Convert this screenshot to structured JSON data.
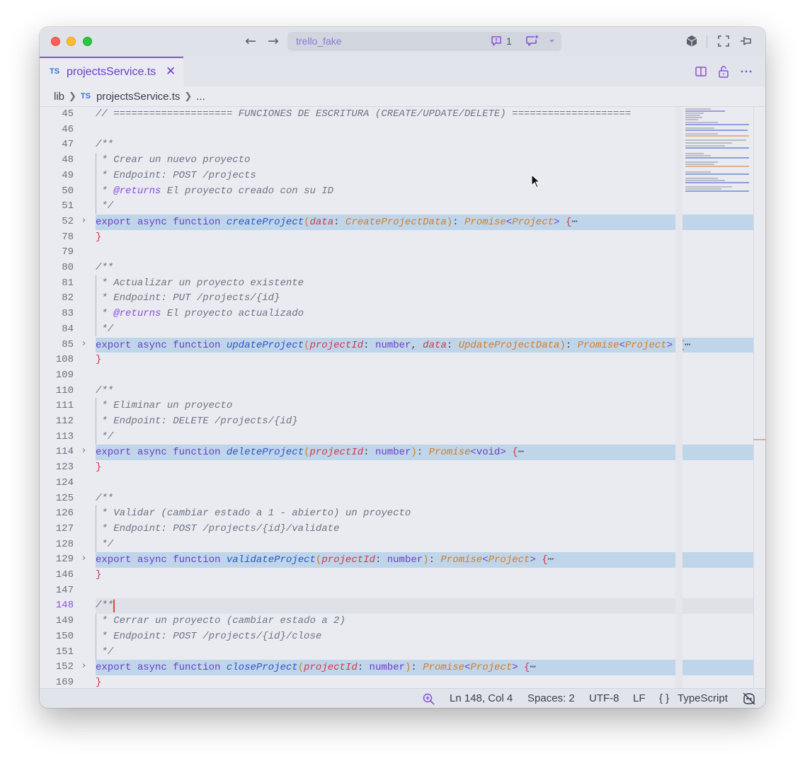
{
  "titlebar": {
    "search_text": "trello_fake",
    "notifications_count": "1"
  },
  "tab": {
    "badge": "TS",
    "label": "projectsService.ts",
    "close": "✕"
  },
  "breadcrumb": {
    "folder": "lib",
    "file": "projectsService.ts",
    "more": "..."
  },
  "editor": {
    "lines": [
      {
        "n": "45"
      },
      {
        "n": "46"
      },
      {
        "n": "47"
      },
      {
        "n": "48"
      },
      {
        "n": "49"
      },
      {
        "n": "50"
      },
      {
        "n": "51"
      },
      {
        "n": "52"
      },
      {
        "n": "78"
      },
      {
        "n": "79"
      },
      {
        "n": "80"
      },
      {
        "n": "81"
      },
      {
        "n": "82"
      },
      {
        "n": "83"
      },
      {
        "n": "84"
      },
      {
        "n": "85"
      },
      {
        "n": "108"
      },
      {
        "n": "109"
      },
      {
        "n": "110"
      },
      {
        "n": "111"
      },
      {
        "n": "112"
      },
      {
        "n": "113"
      },
      {
        "n": "114"
      },
      {
        "n": "123"
      },
      {
        "n": "124"
      },
      {
        "n": "125"
      },
      {
        "n": "126"
      },
      {
        "n": "127"
      },
      {
        "n": "128"
      },
      {
        "n": "129"
      },
      {
        "n": "146"
      },
      {
        "n": "147"
      },
      {
        "n": "148"
      },
      {
        "n": "149"
      },
      {
        "n": "150"
      },
      {
        "n": "151"
      },
      {
        "n": "152"
      },
      {
        "n": "169"
      }
    ],
    "t": {
      "l45": "// ==================== FUNCIONES DE ESCRITURA (CREATE/UPDATE/DELETE) ====================",
      "open": "/**",
      "close": " */",
      "l48": " * Crear un nuevo proyecto",
      "l49": " * Endpoint: POST /projects",
      "star": " * ",
      "returns": "@returns",
      "l50b": " El proyecto creado con su ID",
      "export": "export",
      "async": "async",
      "function": "function",
      "createProject": "createProject",
      "data": "data",
      "CreateProjectData": "CreateProjectData",
      "Promise": "Promise",
      "Project": "Project",
      "rbrace": "}",
      "lbrace": "{",
      "ellipsis": "⋯",
      "l81": " * Actualizar un proyecto existente",
      "l82": " * Endpoint: PUT /projects/{id}",
      "l83b": " El proyecto actualizado",
      "updateProject": "updateProject",
      "projectId": "projectId",
      "number": "number",
      "UpdateProjectData": "UpdateProjectData",
      "l111": " * Eliminar un proyecto",
      "l112": " * Endpoint: DELETE /projects/{id}",
      "deleteProject": "deleteProject",
      "void": "void",
      "l126": " * Validar (cambiar estado a 1 - abierto) un proyecto",
      "l127": " * Endpoint: POST /projects/{id}/validate",
      "validateProject": "validateProject",
      "l149": " * Cerrar un proyecto (cambiar estado a 2)",
      "l150": " * Endpoint: POST /projects/{id}/close",
      "closeProject": "closeProject"
    }
  },
  "statusbar": {
    "position": "Ln 148, Col 4",
    "spaces": "Spaces: 2",
    "encoding": "UTF-8",
    "eol": "LF",
    "lang_braces": "{ }",
    "language": "TypeScript"
  },
  "colors": {
    "accent": "#8a4fd8",
    "folded_bg": "#bfd5ea",
    "keyword": "#6a3fc8",
    "function": "#2f54c7",
    "param": "#d2374b",
    "type": "#d97a22"
  }
}
